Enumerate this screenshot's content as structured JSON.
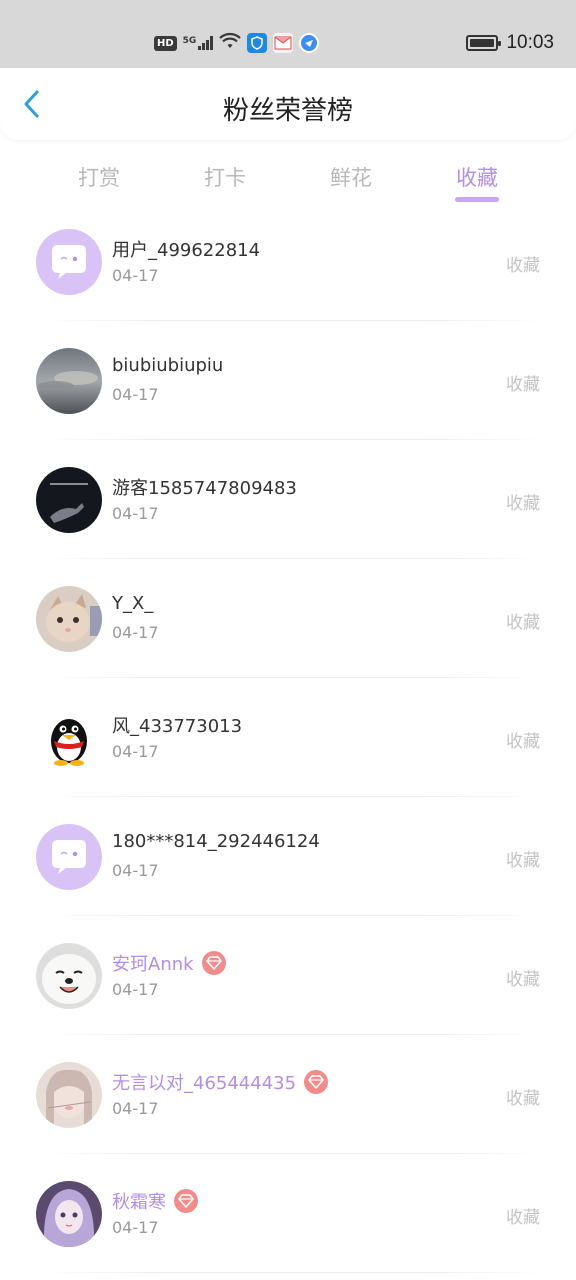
{
  "status_bar": {
    "hd": "HD",
    "network": "5G",
    "time": "10:03",
    "battery_level": 0.95
  },
  "header": {
    "title": "粉丝荣誉榜"
  },
  "tabs": [
    {
      "label": "打赏",
      "active": false
    },
    {
      "label": "打卡",
      "active": false
    },
    {
      "label": "鲜花",
      "active": false
    },
    {
      "label": "收藏",
      "active": true
    }
  ],
  "colors": {
    "accent": "#b48ee6",
    "status_bar_bg": "#d8d8d8",
    "gem": "#f08c8c",
    "back_arrow": "#2a9fd8"
  },
  "fans": [
    {
      "name": "用户_499622814",
      "date": "04-17",
      "action": "收藏",
      "vip": false,
      "avatar": "default-chat-avatar"
    },
    {
      "name": "biubiubiupiu",
      "date": "04-17",
      "action": "收藏",
      "vip": false,
      "avatar": "sky-photo-avatar"
    },
    {
      "name": "游客1585747809483",
      "date": "04-17",
      "action": "收藏",
      "vip": false,
      "avatar": "dark-hand-avatar"
    },
    {
      "name": "Y_X_",
      "date": "04-17",
      "action": "收藏",
      "vip": false,
      "avatar": "cat-avatar"
    },
    {
      "name": "风_433773013",
      "date": "04-17",
      "action": "收藏",
      "vip": false,
      "avatar": "penguin-avatar"
    },
    {
      "name": "180***814_292446124",
      "date": "04-17",
      "action": "收藏",
      "vip": false,
      "avatar": "default-chat-avatar"
    },
    {
      "name": "安珂Annk",
      "date": "04-17",
      "action": "收藏",
      "vip": true,
      "avatar": "dog-avatar"
    },
    {
      "name": "无言以对_465444435",
      "date": "04-17",
      "action": "收藏",
      "vip": true,
      "avatar": "girl-avatar"
    },
    {
      "name": "秋霜寒",
      "date": "04-17",
      "action": "收藏",
      "vip": true,
      "avatar": "anime-avatar"
    }
  ]
}
